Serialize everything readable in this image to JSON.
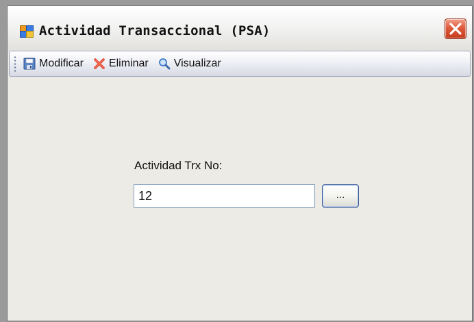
{
  "window": {
    "title": "Actividad Transaccional (PSA)"
  },
  "toolbar": {
    "modify_label": "Modificar",
    "delete_label": "Eliminar",
    "view_label": "Visualizar"
  },
  "form": {
    "label": "Actividad Trx No:",
    "value": "12",
    "browse_label": "..."
  },
  "colors": {
    "close_button": "#d94a2b",
    "toolbar_bg": "#e1e3ec",
    "window_bg": "#ecebe6"
  },
  "icons": [
    "app-icon",
    "close-icon",
    "save-icon",
    "delete-icon",
    "search-icon"
  ]
}
